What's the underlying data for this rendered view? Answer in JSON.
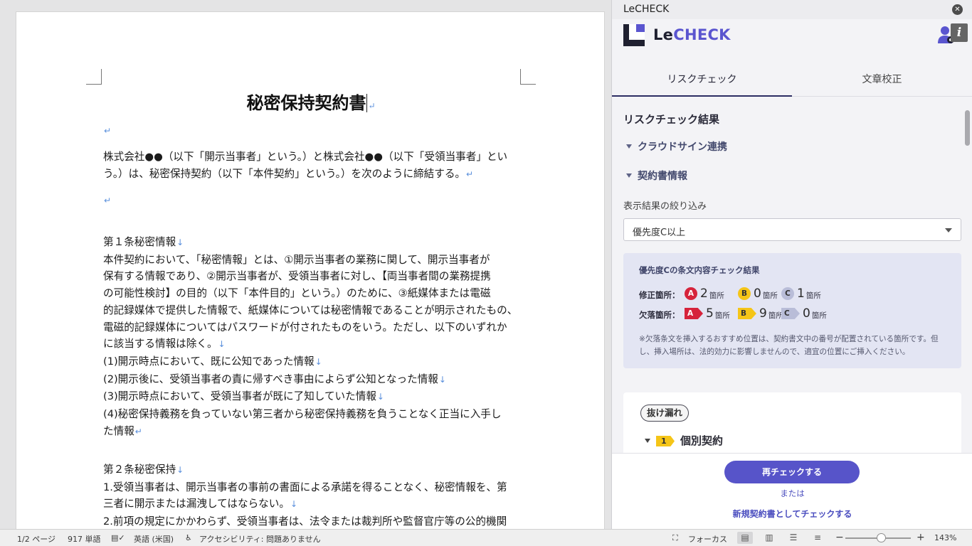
{
  "document": {
    "title": "秘密保持契約書",
    "preamble": [
      "株式会社●●（以下「開示当事者」という。）と株式会社●●（以下「受領当事者」とい",
      "う。）は、秘密保持契約（以下「本件契約」という。）を次のように締結する。"
    ],
    "article1": [
      "第１条秘密情報",
      "本件契約において、「秘密情報」とは、①開示当事者の業務に関して、開示当事者が",
      "保有する情報であり、②開示当事者が、受領当事者に対し、【両当事者間の業務提携",
      "の可能性検討】の目的（以下「本件目的」という。）のために、③紙媒体または電磁",
      "的記録媒体で提供した情報で、紙媒体については秘密情報であることが明示されたもの、",
      "電磁的記録媒体についてはパスワードが付されたものをいう。ただし、以下のいずれか",
      "に該当する情報は除く。",
      "(1)開示時点において、既に公知であった情報",
      "(2)開示後に、受領当事者の責に帰すべき事由によらず公知となった情報",
      "(3)開示時点において、受領当事者が既に了知していた情報",
      "(4)秘密保持義務を負っていない第三者から秘密保持義務を負うことなく正当に入手し",
      "た情報"
    ],
    "article2": [
      "第２条秘密保持",
      "1.受領当事者は、開示当事者の事前の書面による承諾を得ることなく、秘密情報を、第",
      "三者に開示または漏洩してはならない。",
      "2.前項の規定にかかわらず、受領当事者は、法令または裁判所や監督官庁等の公的機関"
    ]
  },
  "status_bar": {
    "page": "1/2 ページ",
    "words": "917 単語",
    "language": "英語 (米国)",
    "accessibility": "アクセシビリティ: 問題ありません",
    "focus": "フォーカス",
    "zoom": "143%",
    "zoom_minus": "−",
    "zoom_plus": "+"
  },
  "pane": {
    "window_title": "LeCHECK",
    "close_glyph": "✕",
    "brand_le": "Le",
    "brand_check": "CHECK",
    "info_glyph": "i",
    "tabs": [
      "リスクチェック",
      "文章校正"
    ],
    "section_title": "リスクチェック結果",
    "collapsibles": [
      "クラウドサイン連携",
      "契約書情報"
    ],
    "filter_label": "表示結果の絞り込み",
    "filter_value": "優先度C以上",
    "summary": {
      "title": "優先度Cの条文内容チェック結果",
      "correction_label": "修正箇所：",
      "omission_label": "欠落箇所：",
      "unit": "箇所",
      "corrections": [
        {
          "grade": "A",
          "count": "2",
          "color": "#d6233b",
          "text_color": "#ffffff"
        },
        {
          "grade": "B",
          "count": "0",
          "color": "#f5c518",
          "text_color": "#333333"
        },
        {
          "grade": "C",
          "count": "1",
          "color": "#b9bdd8",
          "text_color": "#333333"
        }
      ],
      "omissions": [
        {
          "grade": "A",
          "count": "5",
          "color": "#d6233b",
          "text_color": "#ffffff"
        },
        {
          "grade": "B",
          "count": "9",
          "color": "#f5c518",
          "text_color": "#333333"
        },
        {
          "grade": "C",
          "count": "0",
          "color": "#b9bdd8",
          "text_color": "#333333"
        }
      ],
      "note": [
        "※欠落条文を挿入するおすすめ位置は、契約書文中の番号が配置されている箇所です。但",
        "し、挿入場所は、法的効力に影響しませんので、適宜の位置にご挿入ください。"
      ]
    },
    "card": {
      "tag": "抜け漏れ",
      "item_number": "1",
      "item_label": "個別契約"
    },
    "recheck_button": "再チェックする",
    "or_text": "または",
    "new_check_link": "新規契約書としてチェックする"
  },
  "colors": {
    "accent": "#5754c9",
    "brand_dark": "#1f2030",
    "summary_bg": "#e3e5f3"
  }
}
